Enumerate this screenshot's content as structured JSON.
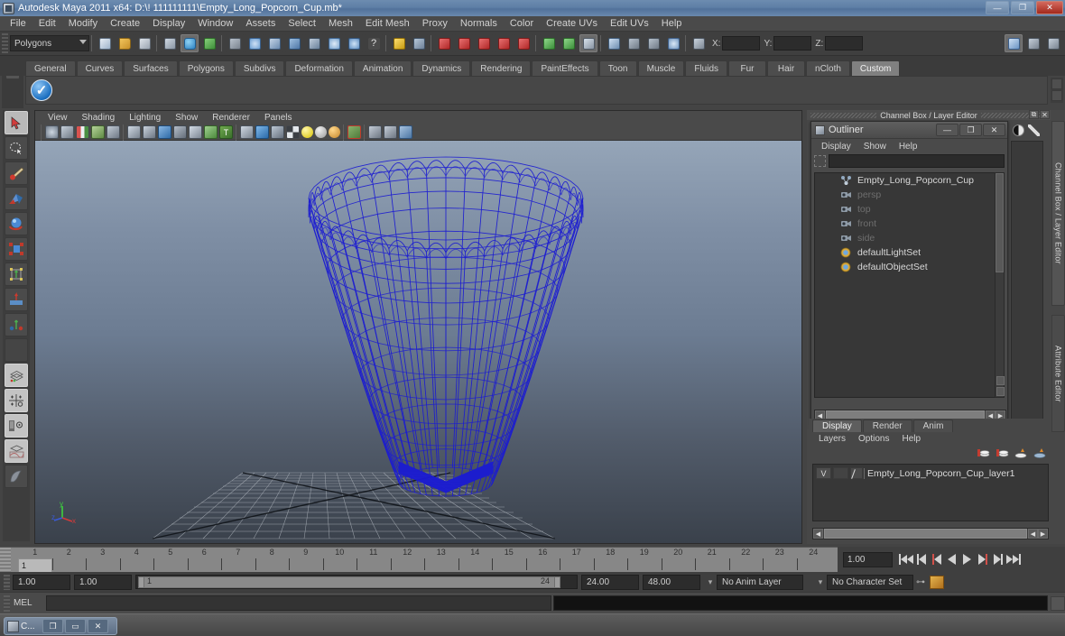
{
  "window": {
    "title": "Autodesk Maya 2011 x64: D:\\! 111111111\\Empty_Long_Popcorn_Cup.mb*",
    "app_icon": "maya-icon",
    "minimize": "—",
    "maximize": "❐",
    "close": "✕"
  },
  "menubar": {
    "items": [
      "File",
      "Edit",
      "Modify",
      "Create",
      "Display",
      "Window",
      "Assets",
      "Select",
      "Mesh",
      "Edit Mesh",
      "Proxy",
      "Normals",
      "Color",
      "Create UVs",
      "Edit UVs",
      "Help"
    ]
  },
  "statusline": {
    "mode_selector": "Polygons",
    "x_label": "X:",
    "y_label": "Y:",
    "z_label": "Z:",
    "x_value": "",
    "y_value": "",
    "z_value": ""
  },
  "shelf": {
    "tabs": [
      "General",
      "Curves",
      "Surfaces",
      "Polygons",
      "Subdivs",
      "Deformation",
      "Animation",
      "Dynamics",
      "Rendering",
      "PaintEffects",
      "Toon",
      "Muscle",
      "Fluids",
      "Fur",
      "Hair",
      "nCloth",
      "Custom"
    ],
    "active_tab": "Custom",
    "buttons": [
      {
        "icon": "blue-check-icon",
        "label": ""
      }
    ]
  },
  "toolbox": {
    "items": [
      {
        "name": "select-tool",
        "icon": "arrow-cursor-icon"
      },
      {
        "name": "lasso-select-tool",
        "icon": "lasso-icon"
      },
      {
        "name": "paint-select-tool",
        "icon": "paint-brush-icon"
      },
      {
        "name": "move-tool",
        "icon": "move-arrows-icon"
      },
      {
        "name": "rotate-tool",
        "icon": "rotate-sphere-icon"
      },
      {
        "name": "scale-tool",
        "icon": "scale-box-icon"
      },
      {
        "name": "universal-manipulator-tool",
        "icon": "universal-manip-icon"
      },
      {
        "name": "soft-modification-tool",
        "icon": "soft-mod-icon"
      },
      {
        "name": "last-tool-used",
        "icon": "last-tool-icon"
      },
      {
        "name": "spacer",
        "icon": "blank-icon"
      },
      {
        "name": "single-perspective-layout",
        "icon": "single-view-icon"
      },
      {
        "name": "four-view-layout",
        "icon": "four-view-icon"
      },
      {
        "name": "outliner-persp-layout",
        "icon": "outliner-persp-icon"
      },
      {
        "name": "persp-graph-layout",
        "icon": "persp-graph-icon"
      },
      {
        "name": "paint-effects-layout",
        "icon": "paint-effects-icon"
      }
    ]
  },
  "viewport": {
    "menus": [
      "View",
      "Shading",
      "Lighting",
      "Show",
      "Renderer",
      "Panels"
    ],
    "axis": {
      "x": "x",
      "y": "y",
      "z": "z"
    },
    "model": {
      "name": "Empty_Long_Popcorn_Cup",
      "wireframe_color": "#1a1ad0",
      "shading": "wireframe",
      "selected": true
    },
    "background_top": "#93a3b6",
    "background_bottom": "#3c434d",
    "grid_color": "#9aa0a8"
  },
  "channel_box_header": {
    "title": "Channel Box / Layer Editor",
    "undock": "⧉",
    "close": "✕"
  },
  "outliner": {
    "title": "Outliner",
    "icon": "outliner-window-icon",
    "minimize": "—",
    "maximize": "❐",
    "close": "✕",
    "menus": [
      "Display",
      "Show",
      "Help"
    ],
    "search_value": "",
    "items": [
      {
        "label": "Empty_Long_Popcorn_Cup",
        "icon": "transform-node-icon",
        "dim": false
      },
      {
        "label": "persp",
        "icon": "camera-icon",
        "dim": true
      },
      {
        "label": "top",
        "icon": "camera-icon",
        "dim": true
      },
      {
        "label": "front",
        "icon": "camera-icon",
        "dim": true
      },
      {
        "label": "side",
        "icon": "camera-icon",
        "dim": true
      },
      {
        "label": "defaultLightSet",
        "icon": "set-icon",
        "dim": false
      },
      {
        "label": "defaultObjectSet",
        "icon": "set-icon",
        "dim": false
      }
    ]
  },
  "layer_editor": {
    "tabs": [
      "Display",
      "Render",
      "Anim"
    ],
    "active_tab": "Display",
    "menus": [
      "Layers",
      "Options",
      "Help"
    ],
    "toolbar_icons": [
      "new-layer-icon",
      "new-layer-from-selected-icon",
      "layer-up-icon",
      "layer-down-icon"
    ],
    "layers": [
      {
        "visibility": "V",
        "playback": "",
        "color_swatch": "layer-color-icon",
        "name": "Empty_Long_Popcorn_Cup_layer1"
      }
    ]
  },
  "side_tabs": {
    "channel_box": "Channel Box / Layer Editor",
    "attribute_editor": "Attribute Editor"
  },
  "timeline": {
    "frames": [
      "1",
      "2",
      "3",
      "4",
      "5",
      "6",
      "7",
      "8",
      "9",
      "10",
      "11",
      "12",
      "13",
      "14",
      "15",
      "16",
      "17",
      "18",
      "19",
      "20",
      "21",
      "22",
      "23",
      "24"
    ],
    "current_frame": "1",
    "current_frame_field": "1.00"
  },
  "playback": {
    "buttons": [
      "go-to-start-icon",
      "step-back-keyframe-icon",
      "step-back-frame-icon",
      "play-backwards-icon",
      "play-forwards-icon",
      "step-forward-frame-icon",
      "step-forward-keyframe-icon",
      "go-to-end-icon"
    ]
  },
  "range": {
    "start_field": "1.00",
    "end_field": "1.00",
    "range_start_label": "1",
    "range_end_label": "24",
    "playback_start": "24.00",
    "playback_end": "48.00",
    "anim_layer": "No Anim Layer",
    "character_set": "No Character Set"
  },
  "command_line": {
    "label": "MEL",
    "input_value": "",
    "output_value": ""
  },
  "taskbar": {
    "item_label": "C...",
    "item_icon": "maya-icon",
    "restore": "❐",
    "maximize": "▭",
    "close": "✕"
  },
  "colors": {
    "title_blue": "#5e7fa6",
    "panel_gray": "#474747",
    "accent_select": "#808080",
    "wire_blue": "#1a1ad0",
    "close_red": "#a3291c"
  }
}
